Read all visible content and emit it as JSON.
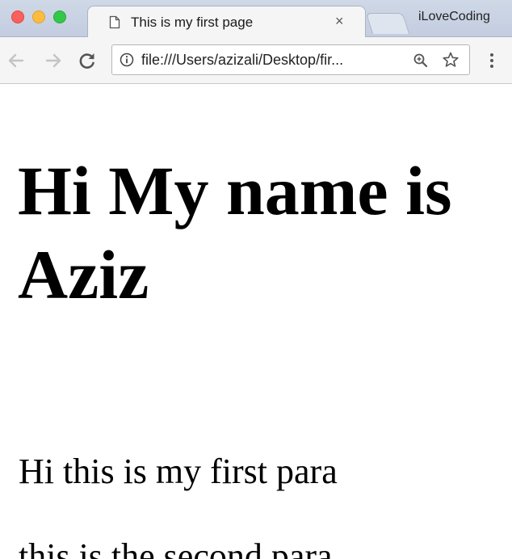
{
  "browser": {
    "tab": {
      "title": "This is my first page",
      "close_glyph": "×",
      "icon": "page-icon"
    },
    "profile_name": "iLoveCoding",
    "window_controls": {
      "close_color": "#fc605c",
      "minimize_color": "#fdbc40",
      "maximize_color": "#34c84a"
    },
    "toolbar": {
      "address_text": "file:///Users/azizali/Desktop/fir...",
      "icons": [
        "back-icon",
        "forward-icon",
        "reload-icon",
        "info-icon",
        "zoom-icon",
        "star-icon",
        "menu-icon"
      ]
    }
  },
  "page": {
    "heading": "Hi My name is Aziz",
    "paragraphs": [
      "Hi this is my first para",
      "this is the second para"
    ]
  }
}
